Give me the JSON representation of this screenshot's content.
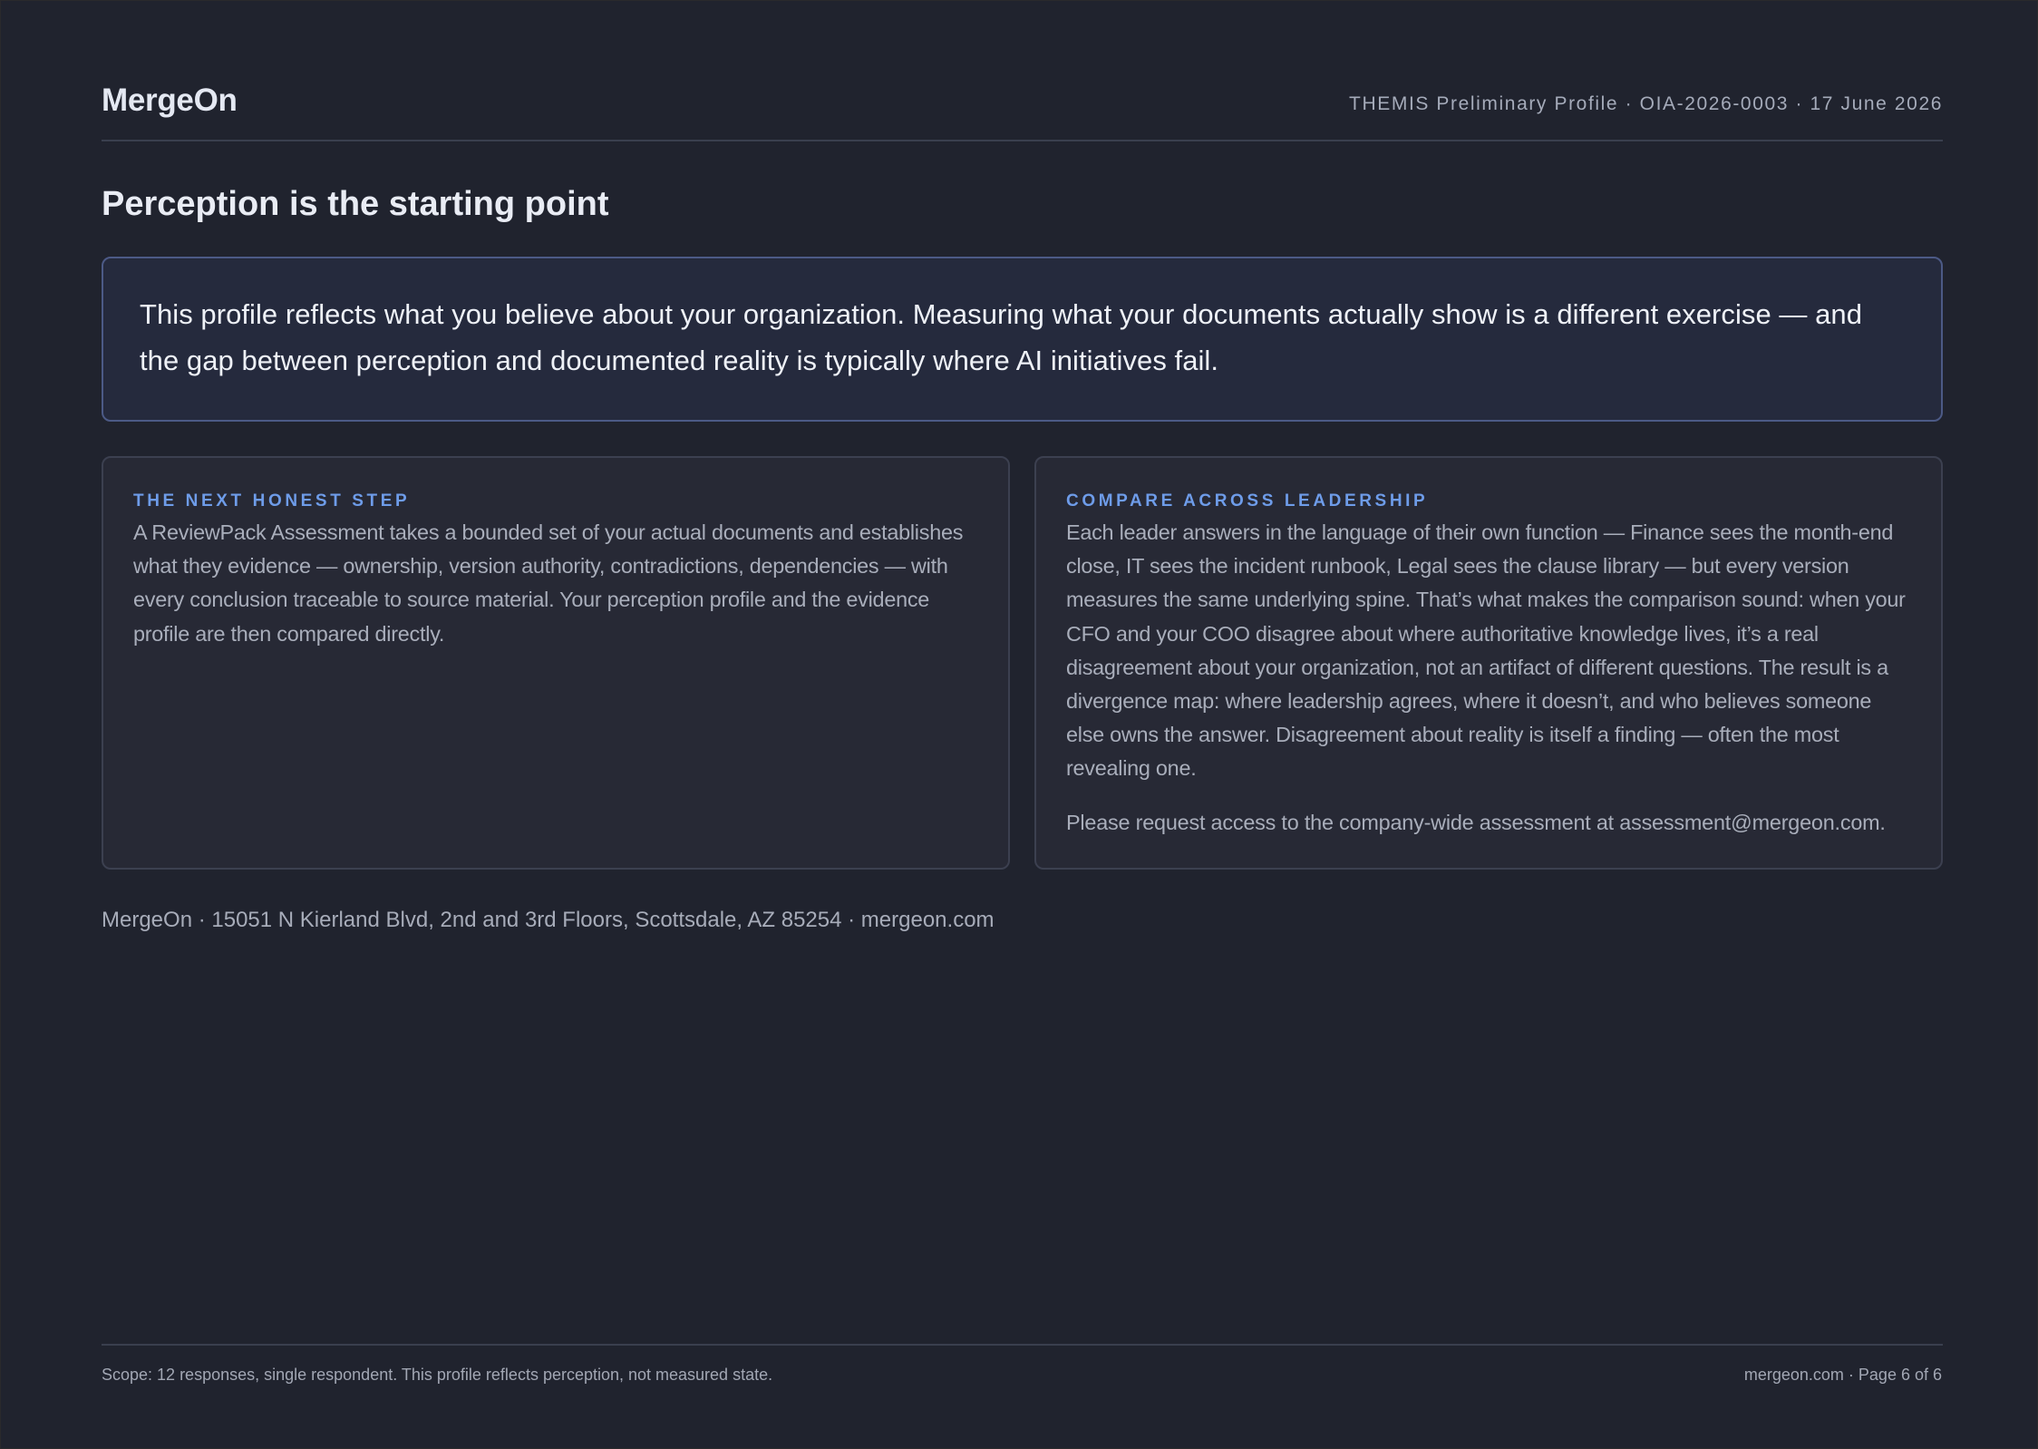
{
  "header": {
    "brand": "MergeOn",
    "meta": "THEMIS Preliminary Profile · OIA-2026-0003 · 17 June 2026"
  },
  "page_title": "Perception is the starting point",
  "callout": {
    "text": "This profile reflects what you believe about your organization. Measuring what your documents actually show is a different exercise — and the gap between perception and documented reality is typically where AI initiatives fail."
  },
  "cards": [
    {
      "title": "THE NEXT HONEST STEP",
      "body": "A ReviewPack Assessment takes a bounded set of your actual documents and establishes what they evidence — ownership, version authority, contradictions, dependencies — with every conclusion traceable to source material. Your perception profile and the evidence profile are then compared directly."
    },
    {
      "title": "COMPARE ACROSS LEADERSHIP",
      "body": "Each leader answers in the language of their own function — Finance sees the month-end close, IT sees the incident runbook, Legal sees the clause library — but every version measures the same underlying spine. That’s what makes the comparison sound: when your CFO and your COO disagree about where authoritative knowledge lives, it’s a real disagreement about your organization, not an artifact of different questions. The result is a divergence map: where leadership agrees, where it doesn’t, and who believes someone else owns the answer. Disagreement about reality is itself a finding — often the most revealing one.",
      "note": "Please request access to the company-wide assessment at assessment@mergeon.com."
    }
  ],
  "address": "MergeOn · 15051 N Kierland Blvd, 2nd and 3rd Floors, Scottsdale, AZ 85254 · mergeon.com",
  "footer": {
    "scope": "Scope: 12 responses, single respondent. This profile reflects perception, not measured state.",
    "page": "mergeon.com · Page 6 of 6"
  },
  "colors": {
    "background": "#20232e",
    "accent": "#6e9ce9",
    "callout_border": "#4c5a86"
  }
}
